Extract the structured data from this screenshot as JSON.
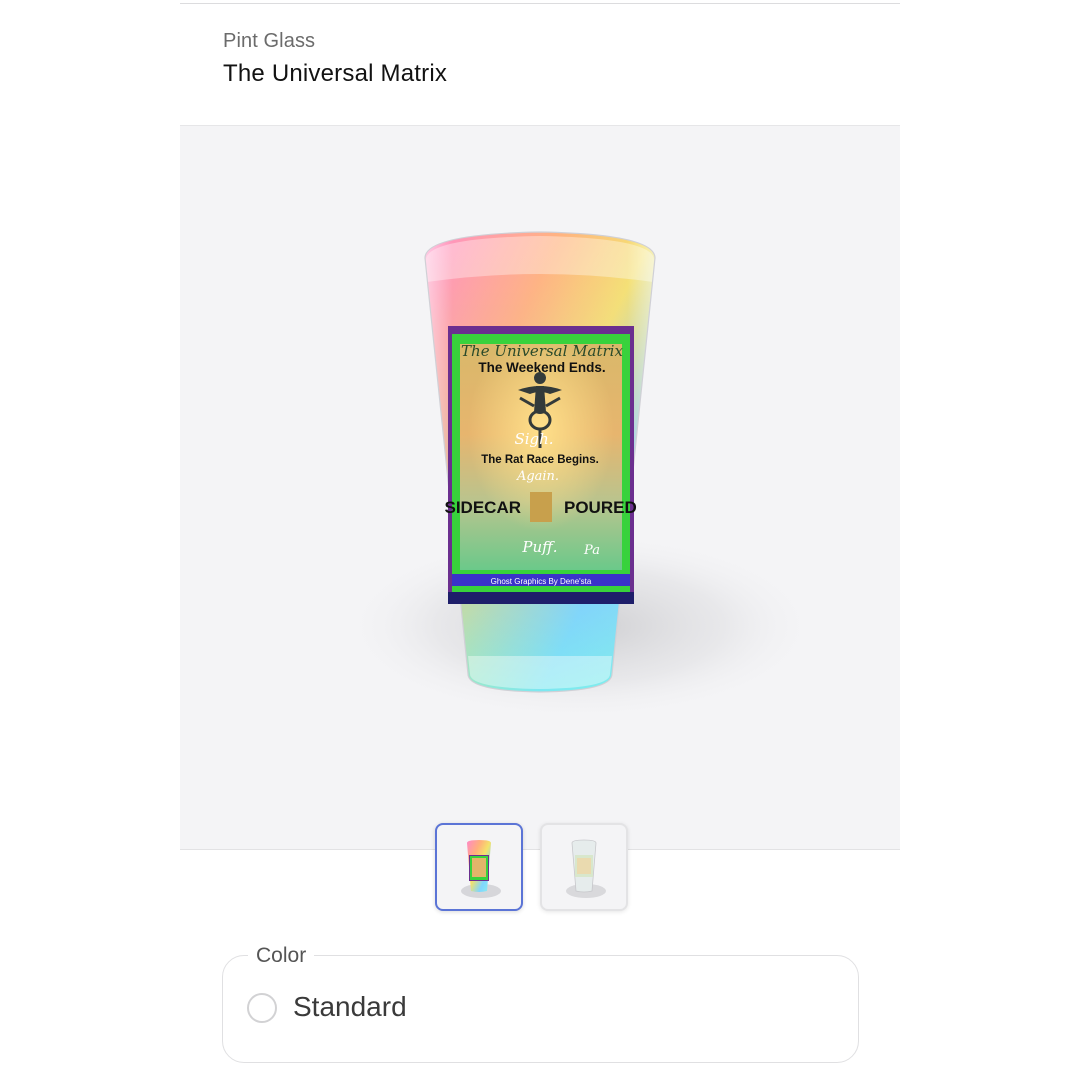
{
  "product": {
    "category": "Pint Glass",
    "title": "The Universal Matrix"
  },
  "design": {
    "script_title": "The Universal Matrix",
    "line_1": "The Weekend Ends.",
    "line_2": "Sigh.",
    "line_3": "The Rat Race Begins.",
    "line_4": "Again.",
    "line_5_left": "SIDECAR",
    "line_5_right": "POURED",
    "line_6": "Puff.",
    "line_6b": "Pa",
    "credit": "Ghost Graphics By Dene'sta"
  },
  "gallery": {
    "thumbnails": [
      {
        "alt": "Front view",
        "selected": true
      },
      {
        "alt": "Alternate view",
        "selected": false
      }
    ],
    "selected_border_color": "#5b74d6"
  },
  "options": {
    "color_legend": "Color",
    "color_choices": [
      {
        "label": "Standard",
        "selected": false
      }
    ]
  }
}
